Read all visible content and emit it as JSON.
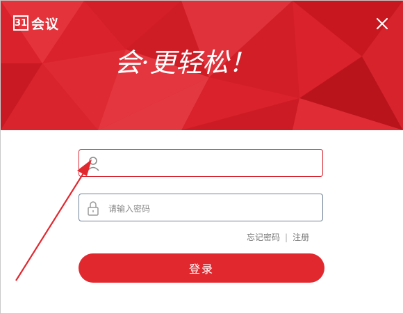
{
  "app": {
    "logo_mark": "31",
    "logo_text": "会议",
    "slogan": "会·更轻松！"
  },
  "login_form": {
    "username_value": "",
    "password_placeholder": "请输入密码",
    "forgot_password_label": "忘记密码",
    "separator": "|",
    "register_label": "注册",
    "login_button_label": "登录"
  },
  "colors": {
    "brand_red": "#d9222b",
    "button_red": "#e1282f",
    "active_border": "#d62631"
  },
  "icons": [
    "close-icon",
    "user-icon",
    "lock-icon",
    "annotation-arrow"
  ]
}
